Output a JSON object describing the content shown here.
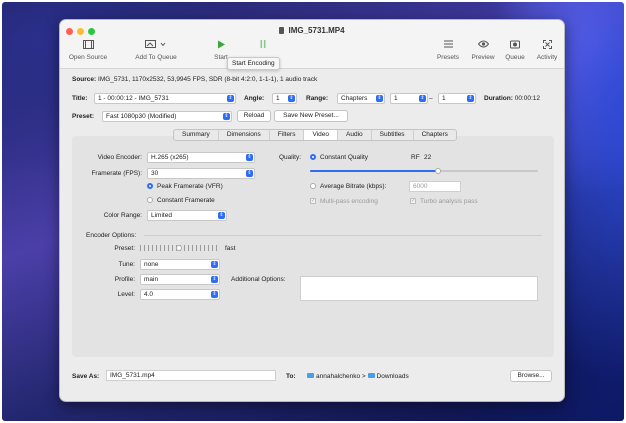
{
  "window": {
    "title": "IMG_5731.MP4"
  },
  "toolbar": {
    "open_source": "Open Source",
    "add_to_queue": "Add To Queue",
    "start": "Start",
    "presets": "Presets",
    "preview": "Preview",
    "queue": "Queue",
    "activity": "Activity",
    "tooltip": "Start Encoding"
  },
  "source": {
    "label": "Source:",
    "value": "IMG_5731, 1170x2532, 53,9945 FPS, SDR (8-bit 4:2:0, 1-1-1), 1 audio track"
  },
  "title_row": {
    "title_label": "Title:",
    "title_value": "1 - 00:00:12 - IMG_5731",
    "angle_label": "Angle:",
    "angle_value": "1",
    "range_label": "Range:",
    "range_type": "Chapters",
    "range_start": "1",
    "range_sep": "–",
    "range_end": "1",
    "duration_label": "Duration:",
    "duration_value": "00:00:12"
  },
  "preset_row": {
    "label": "Preset:",
    "value": "Fast 1080p30 (Modified)",
    "reload": "Reload",
    "save_new": "Save New Preset..."
  },
  "tabs": [
    "Summary",
    "Dimensions",
    "Filters",
    "Video",
    "Audio",
    "Subtitles",
    "Chapters"
  ],
  "active_tab": "Video",
  "video": {
    "encoder_label": "Video Encoder:",
    "encoder_value": "H.265 (x265)",
    "framerate_label": "Framerate (FPS):",
    "framerate_value": "30",
    "peak_framerate": "Peak Framerate (VFR)",
    "constant_framerate": "Constant Framerate",
    "color_range_label": "Color Range:",
    "color_range_value": "Limited",
    "quality_label": "Quality:",
    "constant_quality": "Constant Quality",
    "rf_label": "RF",
    "rf_value": "22",
    "average_bitrate": "Average Bitrate (kbps):",
    "bitrate_value": "6000",
    "multipass": "Multi-pass encoding",
    "turbo": "Turbo analysis pass",
    "quality_slider_level": 0.56
  },
  "encoder_options": {
    "heading": "Encoder Options:",
    "preset_label": "Preset:",
    "preset_value": "fast",
    "preset_slider_level": 0.5,
    "tune_label": "Tune:",
    "tune_value": "none",
    "profile_label": "Profile:",
    "profile_value": "main",
    "level_label": "Level:",
    "level_value": "4.0",
    "additional_label": "Additional Options:"
  },
  "footer": {
    "save_as_label": "Save As:",
    "save_as_value": "IMG_5731.mp4",
    "to_label": "To:",
    "path_user": "annahalchenko",
    "path_sep": ">",
    "path_folder": "Downloads",
    "browse": "Browse..."
  },
  "colors": {
    "accent": "#2d6cf6",
    "start_green": "#3aa53a"
  }
}
